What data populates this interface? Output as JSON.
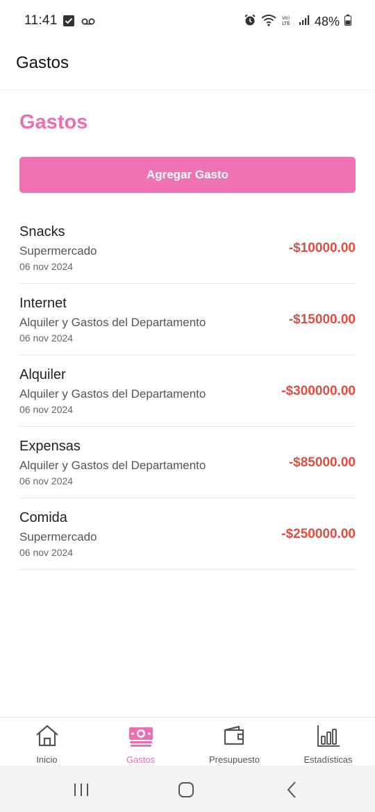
{
  "status_bar": {
    "time": "11:41",
    "battery": "48%"
  },
  "app_bar": {
    "title": "Gastos"
  },
  "main": {
    "section_title": "Gastos",
    "add_button_label": "Agregar Gasto",
    "expenses": [
      {
        "name": "Snacks",
        "category": "Supermercado",
        "date": "06 nov 2024",
        "amount": "-$10000.00"
      },
      {
        "name": "Internet",
        "category": "Alquiler y Gastos del Departamento",
        "date": "06 nov 2024",
        "amount": "-$15000.00"
      },
      {
        "name": "Alquiler",
        "category": "Alquiler y Gastos del Departamento",
        "date": "06 nov 2024",
        "amount": "-$300000.00"
      },
      {
        "name": "Expensas",
        "category": "Alquiler y Gastos del Departamento",
        "date": "06 nov 2024",
        "amount": "-$85000.00"
      },
      {
        "name": "Comida",
        "category": "Supermercado",
        "date": "06 nov 2024",
        "amount": "-$250000.00"
      }
    ]
  },
  "bottom_nav": {
    "items": [
      {
        "label": "Inicio",
        "icon": "home-icon",
        "active": false
      },
      {
        "label": "Gastos",
        "icon": "money-icon",
        "active": true
      },
      {
        "label": "Presupuesto",
        "icon": "wallet-icon",
        "active": false
      },
      {
        "label": "Estadísticas",
        "icon": "bar-chart-icon",
        "active": false
      }
    ]
  },
  "colors": {
    "accent": "#ec6eb1",
    "button": "#ef73b3",
    "negative_amount": "#dd4f43"
  }
}
